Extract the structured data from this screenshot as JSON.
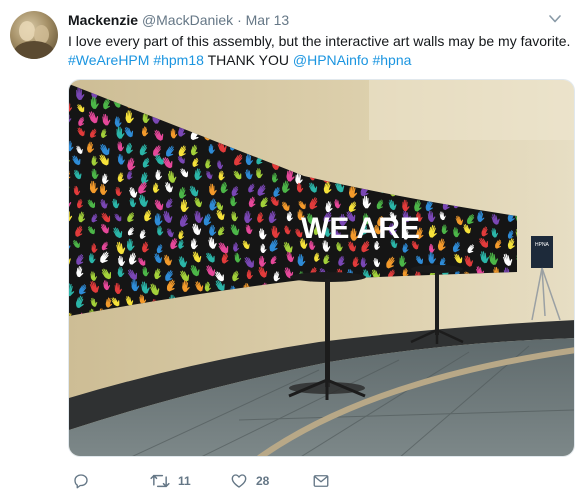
{
  "tweet": {
    "display_name": "Mackenzie",
    "handle": "@MackDaniek",
    "separator": "·",
    "date": "Mar 13",
    "text_plain": "I love every part of this assembly, but the interactive art walls may be my favorite.",
    "hashtag_1": "#WeAreHPM",
    "hashtag_2": "#hpm18",
    "thanks": "THANK YOU",
    "mention": "@HPNAinfo",
    "hashtag_3": "#hpna"
  },
  "media": {
    "wall_text": "WE ARE",
    "sign_text": "HPNA"
  },
  "actions": {
    "reply_icon": "reply-icon",
    "retweet_icon": "retweet-icon",
    "retweet_count": "11",
    "like_icon": "heart-icon",
    "like_count": "28",
    "dm_icon": "envelope-icon"
  },
  "colors": {
    "link": "#1b95e0",
    "secondary_text": "#657786",
    "primary_text": "#14171a"
  }
}
